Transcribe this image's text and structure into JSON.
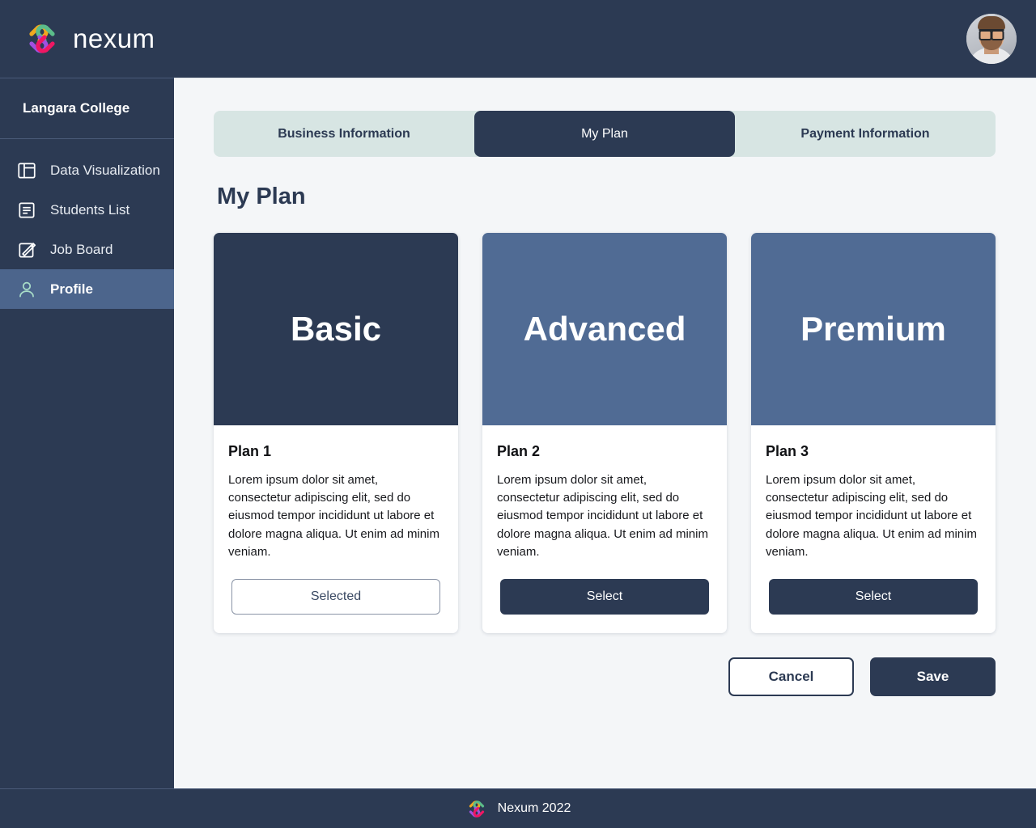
{
  "brand": {
    "name": "nexum",
    "logo_icon": "nexum-interlocking-links-logo",
    "logo_colors": {
      "orange": "#f0a81e",
      "green": "#5bbd8a",
      "purple": "#a050e0",
      "pink": "#ef1763"
    }
  },
  "topbar": {
    "avatar_icon": "user-avatar-photo"
  },
  "sidebar": {
    "org_name": "Langara College",
    "items": [
      {
        "label": "Data Visualization",
        "icon": "layout-panels-icon",
        "active": false
      },
      {
        "label": "Students List",
        "icon": "document-list-icon",
        "active": false
      },
      {
        "label": "Job Board",
        "icon": "pencil-square-icon",
        "active": false
      },
      {
        "label": "Profile",
        "icon": "person-icon",
        "active": true
      }
    ]
  },
  "tabs": [
    {
      "label": "Business Information",
      "active": false
    },
    {
      "label": "My Plan",
      "active": true
    },
    {
      "label": "Payment Information",
      "active": false
    }
  ],
  "main": {
    "title": "My Plan"
  },
  "plans": [
    {
      "tier": "Basic",
      "header_color": "#2c3a53",
      "name": "Plan 1",
      "description": "Lorem ipsum dolor sit amet, consectetur adipiscing elit, sed do eiusmod tempor incididunt ut labore et dolore magna aliqua. Ut enim ad minim veniam.",
      "button_label": "Selected",
      "selected": true
    },
    {
      "tier": "Advanced",
      "header_color": "#506b94",
      "name": "Plan 2",
      "description": "Lorem ipsum dolor sit amet, consectetur adipiscing elit, sed do eiusmod tempor incididunt ut labore et dolore magna aliqua. Ut enim ad minim veniam.",
      "button_label": "Select",
      "selected": false
    },
    {
      "tier": "Premium",
      "header_color": "#506b94",
      "name": "Plan 3",
      "description": "Lorem ipsum dolor sit amet, consectetur adipiscing elit, sed do eiusmod tempor incididunt ut labore et dolore magna aliqua. Ut enim ad minim veniam.",
      "button_label": "Select",
      "selected": false
    }
  ],
  "actions": {
    "cancel_label": "Cancel",
    "save_label": "Save"
  },
  "footer": {
    "text": "Nexum 2022",
    "logo_icon": "nexum-interlocking-links-logo"
  },
  "theme": {
    "navy": "#2c3a53",
    "slate_blue": "#506b94",
    "tabbar_bg": "#d7e5e3",
    "content_bg": "#f4f6f8",
    "sidebar_active": "#4c658c"
  }
}
